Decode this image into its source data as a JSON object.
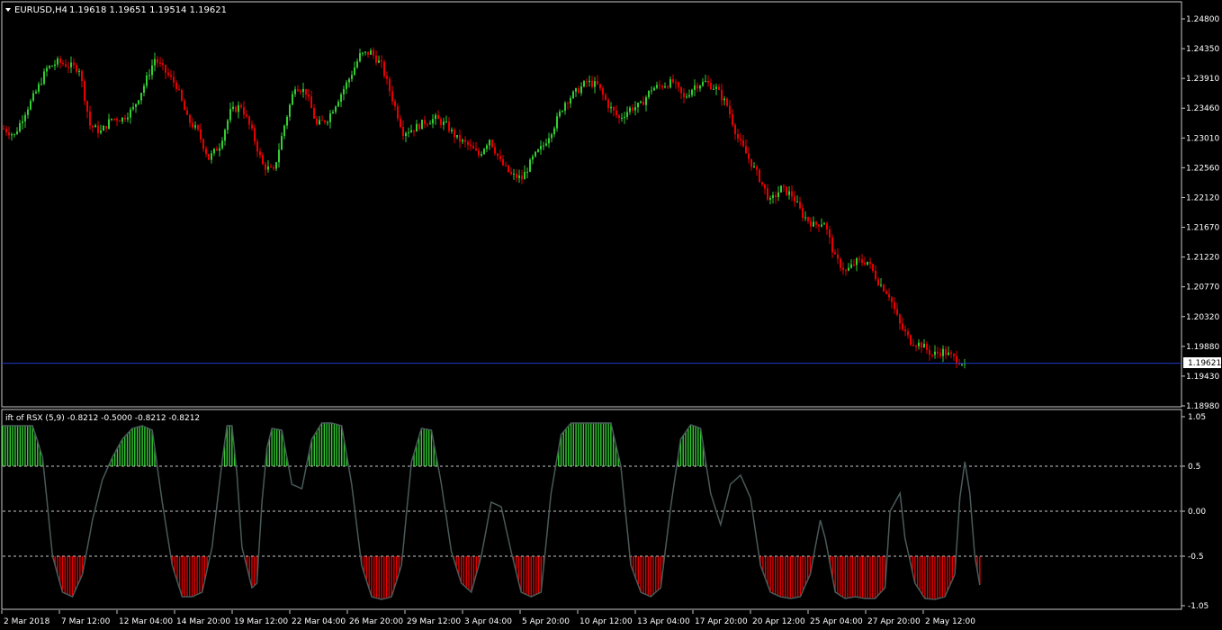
{
  "header": {
    "symbol": "EURUSD,H4",
    "ohlc": "1.19618 1.19651 1.19514 1.19621"
  },
  "indicator": {
    "label": "ift of RSX (5,9) -0.8212 -0.5000 -0.8212 -0.8212"
  },
  "colors": {
    "background": "#000000",
    "frame": "#c8c8c8",
    "bull_candle": "#33cc33",
    "bear_candle": "#e60000",
    "indicator_line": "#4a5a5a",
    "indicator_fill_up": "#33cc33",
    "indicator_fill_down": "#e60000",
    "bid_line": "#1e3cc8",
    "level_lines": "#c8c8c8"
  },
  "price_axis": {
    "labels": [
      "1.24800",
      "1.24350",
      "1.23910",
      "1.23460",
      "1.23010",
      "1.22560",
      "1.22120",
      "1.21670",
      "1.21220",
      "1.20770",
      "1.20320",
      "1.19880",
      "1.19430",
      "1.18980"
    ],
    "current_price": "1.19621"
  },
  "indicator_axis": {
    "labels": [
      "1.05",
      "0.5",
      "0.00",
      "-0.5",
      "-1.05"
    ],
    "levels": [
      0.5,
      0.0,
      -0.5
    ]
  },
  "time_axis": {
    "labels": [
      "2 Mar 2018",
      "7 Mar 12:00",
      "12 Mar 04:00",
      "14 Mar 20:00",
      "19 Mar 12:00",
      "22 Mar 04:00",
      "26 Mar 20:00",
      "29 Mar 12:00",
      "3 Apr 04:00",
      "5 Apr 20:00",
      "10 Apr 12:00",
      "13 Apr 04:00",
      "17 Apr 20:00",
      "20 Apr 12:00",
      "25 Apr 04:00",
      "27 Apr 20:00",
      "2 May 12:00"
    ]
  },
  "chart_data": [
    {
      "type": "candlestick",
      "symbol": "EURUSD",
      "timeframe": "H4",
      "ylim": [
        1.1898,
        1.248
      ],
      "close_path": [
        [
          0,
          1.2315
        ],
        [
          4,
          1.2305
        ],
        [
          8,
          1.234
        ],
        [
          12,
          1.237
        ],
        [
          16,
          1.2405
        ],
        [
          20,
          1.2415
        ],
        [
          24,
          1.241
        ],
        [
          28,
          1.2405
        ],
        [
          32,
          1.232
        ],
        [
          36,
          1.231
        ],
        [
          40,
          1.233
        ],
        [
          44,
          1.233
        ],
        [
          48,
          1.2345
        ],
        [
          52,
          1.238
        ],
        [
          56,
          1.242
        ],
        [
          60,
          1.24
        ],
        [
          64,
          1.238
        ],
        [
          68,
          1.233
        ],
        [
          72,
          1.231
        ],
        [
          76,
          1.227
        ],
        [
          80,
          1.229
        ],
        [
          84,
          1.234
        ],
        [
          88,
          1.235
        ],
        [
          92,
          1.231
        ],
        [
          96,
          1.226
        ],
        [
          100,
          1.225
        ],
        [
          104,
          1.232
        ],
        [
          108,
          1.238
        ],
        [
          112,
          1.237
        ],
        [
          116,
          1.232
        ],
        [
          120,
          1.233
        ],
        [
          124,
          1.236
        ],
        [
          128,
          1.239
        ],
        [
          132,
          1.2425
        ],
        [
          136,
          1.243
        ],
        [
          140,
          1.241
        ],
        [
          144,
          1.236
        ],
        [
          148,
          1.231
        ],
        [
          152,
          1.2315
        ],
        [
          156,
          1.2325
        ],
        [
          160,
          1.233
        ],
        [
          164,
          1.232
        ],
        [
          168,
          1.23
        ],
        [
          172,
          1.229
        ],
        [
          176,
          1.2275
        ],
        [
          180,
          1.23
        ],
        [
          184,
          1.2265
        ],
        [
          188,
          1.2245
        ],
        [
          192,
          1.224
        ],
        [
          196,
          1.227
        ],
        [
          200,
          1.229
        ],
        [
          204,
          1.232
        ],
        [
          208,
          1.2355
        ],
        [
          212,
          1.237
        ],
        [
          216,
          1.2385
        ],
        [
          220,
          1.238
        ],
        [
          224,
          1.235
        ],
        [
          228,
          1.233
        ],
        [
          232,
          1.2345
        ],
        [
          236,
          1.235
        ],
        [
          240,
          1.2375
        ],
        [
          244,
          1.238
        ],
        [
          248,
          1.2385
        ],
        [
          252,
          1.236
        ],
        [
          256,
          1.238
        ],
        [
          260,
          1.2385
        ],
        [
          264,
          1.2375
        ],
        [
          268,
          1.235
        ],
        [
          272,
          1.23
        ],
        [
          276,
          1.227
        ],
        [
          280,
          1.224
        ],
        [
          284,
          1.2205
        ],
        [
          288,
          1.2225
        ],
        [
          292,
          1.2215
        ],
        [
          296,
          1.2185
        ],
        [
          300,
          1.217
        ],
        [
          304,
          1.2175
        ],
        [
          308,
          1.212
        ],
        [
          312,
          1.21
        ],
        [
          316,
          1.2115
        ],
        [
          320,
          1.2115
        ],
        [
          324,
          1.2085
        ],
        [
          328,
          1.2065
        ],
        [
          332,
          1.202
        ],
        [
          336,
          1.1995
        ],
        [
          340,
          1.199
        ],
        [
          344,
          1.1975
        ],
        [
          348,
          1.198
        ],
        [
          352,
          1.197
        ],
        [
          356,
          1.1962
        ]
      ]
    },
    {
      "type": "area",
      "name": "ift of RSX (5,9)",
      "ylim": [
        -1.05,
        1.05
      ],
      "levels": [
        0.5,
        0.0,
        -0.5
      ],
      "last_value": -0.8212,
      "path": [
        [
          0,
          0.95
        ],
        [
          12,
          0.95
        ],
        [
          16,
          0.6
        ],
        [
          20,
          -0.5
        ],
        [
          24,
          -0.9
        ],
        [
          28,
          -0.95
        ],
        [
          32,
          -0.7
        ],
        [
          36,
          -0.1
        ],
        [
          40,
          0.35
        ],
        [
          44,
          0.6
        ],
        [
          48,
          0.8
        ],
        [
          52,
          0.92
        ],
        [
          56,
          0.95
        ],
        [
          60,
          0.9
        ],
        [
          64,
          0.1
        ],
        [
          68,
          -0.6
        ],
        [
          72,
          -0.95
        ],
        [
          76,
          -0.95
        ],
        [
          80,
          -0.9
        ],
        [
          84,
          -0.4
        ],
        [
          88,
          0.55
        ],
        [
          90,
          0.95
        ],
        [
          92,
          0.95
        ],
        [
          94,
          0.4
        ],
        [
          96,
          -0.4
        ],
        [
          100,
          -0.85
        ],
        [
          102,
          -0.8
        ],
        [
          104,
          0.1
        ],
        [
          106,
          0.7
        ],
        [
          108,
          0.92
        ],
        [
          112,
          0.9
        ],
        [
          116,
          0.3
        ],
        [
          120,
          0.25
        ],
        [
          124,
          0.8
        ],
        [
          128,
          0.98
        ],
        [
          132,
          0.98
        ],
        [
          136,
          0.95
        ],
        [
          140,
          0.3
        ],
        [
          144,
          -0.6
        ],
        [
          148,
          -0.95
        ],
        [
          152,
          -0.98
        ],
        [
          156,
          -0.95
        ],
        [
          160,
          -0.6
        ],
        [
          164,
          0.55
        ],
        [
          168,
          0.92
        ],
        [
          172,
          0.9
        ],
        [
          176,
          0.3
        ],
        [
          180,
          -0.45
        ],
        [
          184,
          -0.8
        ],
        [
          188,
          -0.9
        ],
        [
          192,
          -0.5
        ],
        [
          196,
          0.1
        ],
        [
          200,
          0.05
        ],
        [
          204,
          -0.45
        ],
        [
          208,
          -0.9
        ],
        [
          212,
          -0.95
        ],
        [
          216,
          -0.9
        ],
        [
          220,
          0.2
        ],
        [
          224,
          0.85
        ],
        [
          228,
          0.98
        ],
        [
          232,
          0.98
        ],
        [
          236,
          0.98
        ],
        [
          240,
          0.98
        ],
        [
          244,
          0.98
        ],
        [
          248,
          0.5
        ],
        [
          252,
          -0.6
        ],
        [
          256,
          -0.9
        ],
        [
          260,
          -0.95
        ],
        [
          264,
          -0.85
        ],
        [
          268,
          0.05
        ],
        [
          272,
          0.8
        ],
        [
          276,
          0.96
        ],
        [
          280,
          0.92
        ],
        [
          284,
          0.2
        ],
        [
          288,
          -0.15
        ],
        [
          292,
          0.3
        ],
        [
          296,
          0.4
        ],
        [
          300,
          0.15
        ],
        [
          304,
          -0.6
        ],
        [
          308,
          -0.9
        ],
        [
          312,
          -0.95
        ],
        [
          316,
          -0.97
        ],
        [
          320,
          -0.95
        ],
        [
          324,
          -0.7
        ],
        [
          328,
          -0.1
        ],
        [
          330,
          -0.3
        ],
        [
          334,
          -0.9
        ],
        [
          338,
          -0.97
        ],
        [
          342,
          -0.95
        ],
        [
          346,
          -0.97
        ],
        [
          350,
          -0.97
        ],
        [
          354,
          -0.85
        ],
        [
          356,
          0.0
        ],
        [
          360,
          0.2
        ],
        [
          362,
          -0.3
        ],
        [
          366,
          -0.8
        ],
        [
          370,
          -0.97
        ],
        [
          374,
          -0.98
        ],
        [
          378,
          -0.95
        ],
        [
          382,
          -0.7
        ],
        [
          384,
          0.15
        ],
        [
          386,
          0.55
        ],
        [
          388,
          0.2
        ],
        [
          390,
          -0.5
        ],
        [
          392,
          -0.82
        ]
      ]
    }
  ]
}
